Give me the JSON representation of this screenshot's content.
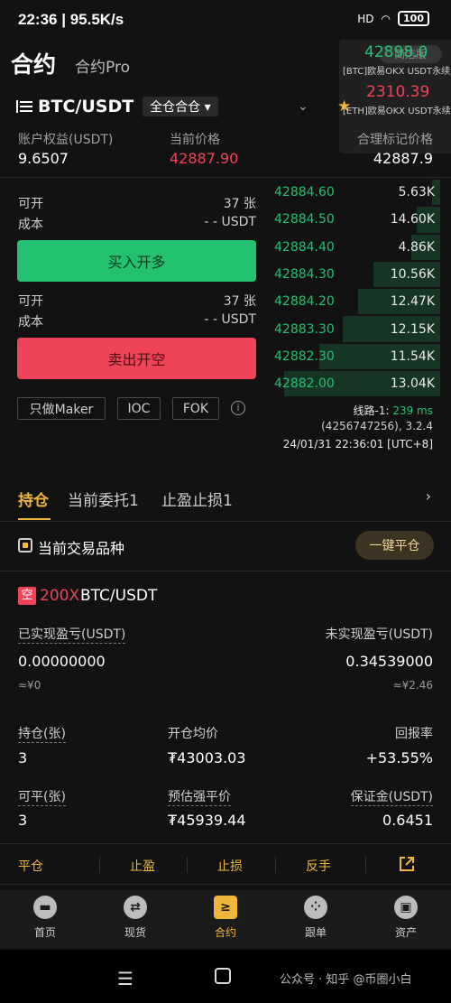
{
  "status": {
    "time": "22:36",
    "speed": "95.5K/s",
    "signal": "HD",
    "battery": "100"
  },
  "header": {
    "title": "合约",
    "pro": "合约Pro"
  },
  "ticker": {
    "btc_price": "42898.0",
    "btc_label": "[BTC]欧易OKX USDT永续",
    "eth_price": "2310.39",
    "eth_label": "[ETH]欧易OKX USDT永续",
    "badge": "简洁版"
  },
  "pair": {
    "name": "BTC/USDT",
    "mode": "全仓合仓"
  },
  "account": {
    "equity_label": "账户权益(USDT)",
    "equity_value": "9.6507",
    "price_label": "当前价格",
    "price_value": "42887.90",
    "mark_label": "合理标记价格",
    "mark_value": "42887.9"
  },
  "trade": {
    "open_label": "可开",
    "open_value": "37 张",
    "cost_label": "成本",
    "cost_value": "- - USDT",
    "buy_label": "买入开多",
    "sell_label": "卖出开空",
    "options": [
      "只做Maker",
      "IOC",
      "FOK"
    ]
  },
  "book": {
    "rows": [
      {
        "price": "42884.60",
        "qty": "5.63K",
        "depth": 0.05
      },
      {
        "price": "42884.50",
        "qty": "14.60K",
        "depth": 0.14
      },
      {
        "price": "42884.40",
        "qty": "4.86K",
        "depth": 0.17
      },
      {
        "price": "42884.30",
        "qty": "10.56K",
        "depth": 0.4
      },
      {
        "price": "42884.20",
        "qty": "12.47K",
        "depth": 0.49
      },
      {
        "price": "42883.30",
        "qty": "12.15K",
        "depth": 0.58
      },
      {
        "price": "42882.30",
        "qty": "11.54K",
        "depth": 0.72
      },
      {
        "price": "42882.00",
        "qty": "13.04K",
        "depth": 0.93
      }
    ],
    "route": "线路-1: ",
    "route_ms": "239 ms",
    "ident": "(4256747256), 3.2.4",
    "stamp": "24/01/31 22:36:01 [UTC+8]"
  },
  "tabs": {
    "positions": "持仓",
    "orders": "当前委托1",
    "tpsl": "止盈止损1",
    "more": "›"
  },
  "current": {
    "label": "当前交易品种",
    "close_all": "一键平仓"
  },
  "position": {
    "side": "空",
    "leverage": "200X",
    "pair": "BTC/USDT",
    "realized_label": "已实现盈亏(USDT)",
    "realized_value": "0.00000000",
    "realized_sub": "≈¥0",
    "unrealized_label": "未实现盈亏(USDT)",
    "unrealized_value": "0.34539000",
    "unrealized_sub": "≈¥2.46",
    "hold_label": "持仓(张)",
    "hold_value": "3",
    "avg_label": "开仓均价",
    "avg_value": "₮43003.03",
    "roe_label": "回报率",
    "roe_value": "+53.55%",
    "closable_label": "可平(张)",
    "closable_value": "3",
    "liq_label": "预估强平价",
    "liq_value": "₮45939.44",
    "margin_label": "保证金(USDT)",
    "margin_value": "0.6451"
  },
  "actions": [
    "平仓",
    "止盈",
    "止损",
    "反手"
  ],
  "nav": [
    {
      "label": "首页",
      "icon": "home-icon",
      "glyph": "▬"
    },
    {
      "label": "现货",
      "icon": "spot-icon",
      "glyph": "⇄"
    },
    {
      "label": "合约",
      "icon": "contract-icon",
      "glyph": "≥"
    },
    {
      "label": "跟单",
      "icon": "copy-trade-icon",
      "glyph": "⁘"
    },
    {
      "label": "资产",
      "icon": "wallet-icon",
      "glyph": "▣"
    }
  ],
  "watermark": "公众号 · 知乎 @币圈小白",
  "colors": {
    "up": "#22c270",
    "down": "#ef4457",
    "accent": "#f0b63c",
    "bg": "#121212"
  }
}
